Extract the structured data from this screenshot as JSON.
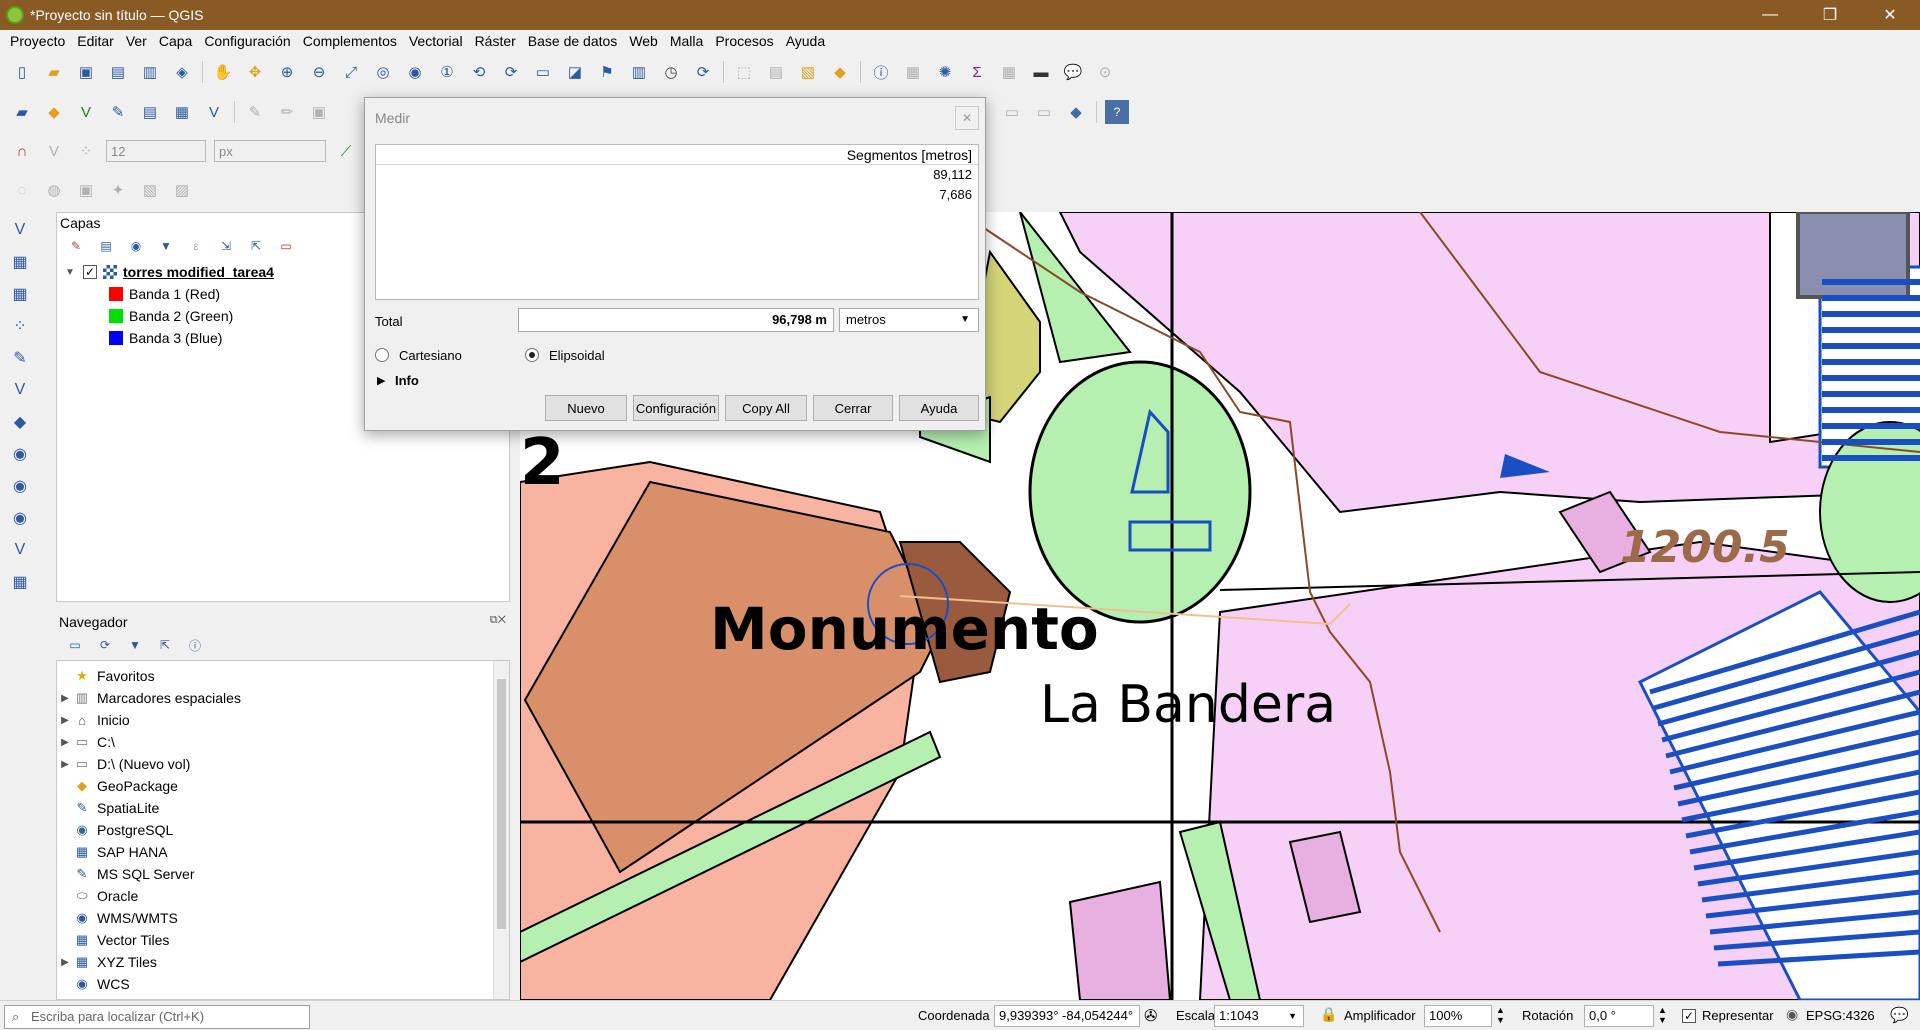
{
  "window": {
    "title": "*Proyecto sin título — QGIS",
    "minimize": "—",
    "maximize": "❐",
    "close": "✕"
  },
  "menu": [
    "Proyecto",
    "Editar",
    "Ver",
    "Capa",
    "Configuración",
    "Complementos",
    "Vectorial",
    "Ráster",
    "Base de datos",
    "Web",
    "Malla",
    "Procesos",
    "Ayuda"
  ],
  "digitizing": {
    "size_value": "12",
    "unit_value": "px"
  },
  "layers_panel": {
    "title": "Capas",
    "layer_name": "torres modified_tarea4",
    "bands": [
      {
        "label": "Banda 1 (Red)",
        "color": "#ff0000"
      },
      {
        "label": "Banda 2 (Green)",
        "color": "#00e000"
      },
      {
        "label": "Banda 3 (Blue)",
        "color": "#0000ff"
      }
    ]
  },
  "browser_panel": {
    "title": "Navegador",
    "items": [
      {
        "label": "Favoritos",
        "icon": "star-icon",
        "expandable": false
      },
      {
        "label": "Marcadores espaciales",
        "icon": "bookmark-icon",
        "expandable": true
      },
      {
        "label": "Inicio",
        "icon": "home-icon",
        "expandable": true
      },
      {
        "label": "C:\\",
        "icon": "folder-icon",
        "expandable": true
      },
      {
        "label": "D:\\ (Nuevo vol)",
        "icon": "folder-icon",
        "expandable": true
      },
      {
        "label": "GeoPackage",
        "icon": "geopackage-icon",
        "expandable": false
      },
      {
        "label": "SpatiaLite",
        "icon": "spatialite-icon",
        "expandable": false
      },
      {
        "label": "PostgreSQL",
        "icon": "postgresql-icon",
        "expandable": false
      },
      {
        "label": "SAP HANA",
        "icon": "sap-hana-icon",
        "expandable": false
      },
      {
        "label": "MS SQL Server",
        "icon": "mssql-icon",
        "expandable": false
      },
      {
        "label": "Oracle",
        "icon": "oracle-icon",
        "expandable": false
      },
      {
        "label": "WMS/WMTS",
        "icon": "globe-icon",
        "expandable": false
      },
      {
        "label": "Vector Tiles",
        "icon": "grid-icon",
        "expandable": false
      },
      {
        "label": "XYZ Tiles",
        "icon": "grid-icon",
        "expandable": true
      },
      {
        "label": "WCS",
        "icon": "globe-icon",
        "expandable": false
      }
    ]
  },
  "measure_dialog": {
    "title": "Medir",
    "segments_header": "Segmentos [metros]",
    "segments": [
      "89,112",
      "7,686"
    ],
    "total_label": "Total",
    "total_value": "96,798 m",
    "unit": "metros",
    "cartesian_label": "Cartesiano",
    "ellipsoidal_label": "Elipsoidal",
    "info_label": "Info",
    "buttons": {
      "new": "Nuevo",
      "config": "Configuración",
      "copy_all": "Copy All",
      "close": "Cerrar",
      "help": "Ayuda"
    }
  },
  "map": {
    "labels": {
      "monumento": "Monumento",
      "bandera": "La Bandera",
      "elevation": "1200.5",
      "partial": "2"
    }
  },
  "statusbar": {
    "locator_placeholder": "Escriba para localizar (Ctrl+K)",
    "coord_label": "Coordenada",
    "coord_value": "9,939393° -84,054244°",
    "scale_label": "Escala",
    "scale_value": "1:1043",
    "magnifier_label": "Amplificador",
    "magnifier_value": "100%",
    "rotation_label": "Rotación",
    "rotation_value": "0,0 °",
    "render_label": "Representar",
    "crs": "EPSG:4326"
  }
}
